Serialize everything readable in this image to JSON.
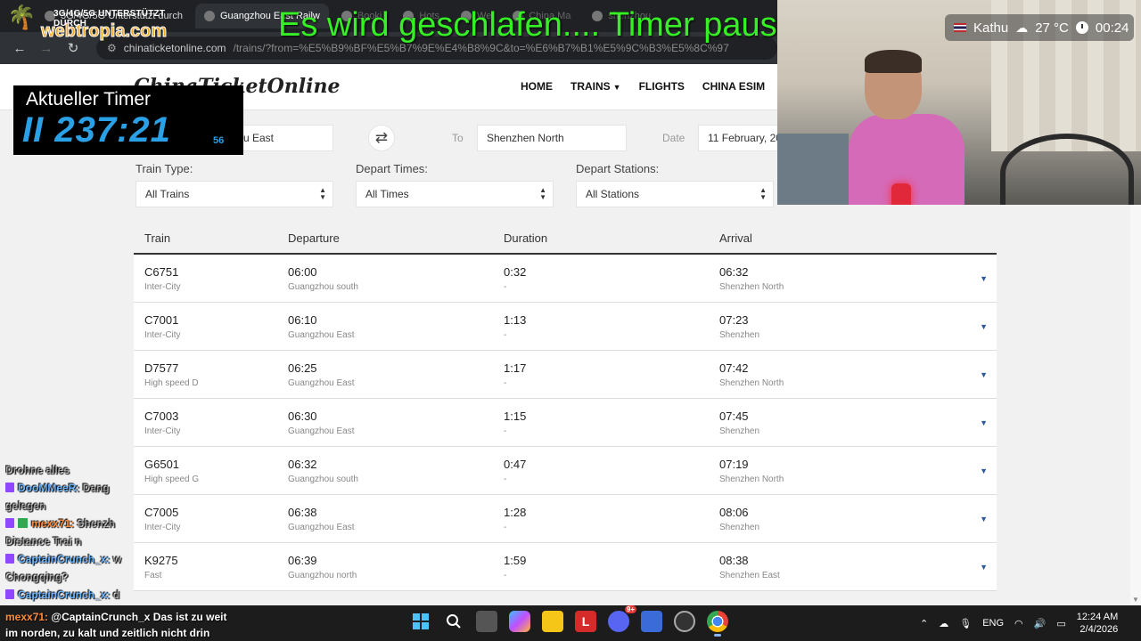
{
  "browser": {
    "tabs": [
      {
        "label": "3G/4G/5G Unterstützt durch",
        "active": false
      },
      {
        "label": "Guangzhou East Railw",
        "active": true
      },
      {
        "label": "Booki",
        "active": false
      },
      {
        "label": "Hots",
        "active": false
      },
      {
        "label": "We",
        "active": false
      },
      {
        "label": "China Ma",
        "active": false
      },
      {
        "label": "shenzhou",
        "active": false
      }
    ],
    "url_host": "chinaticketonline.com",
    "url_path": "/trains/?from=%E5%B9%BF%E5%B7%9E%E4%B8%9C&to=%E6%B7%B1%E5%9C%B3%E5%8C%97"
  },
  "site": {
    "logo": "ChinaTicketOnline",
    "nav": [
      "HOME",
      "TRAINS",
      "FLIGHTS",
      "CHINA ESIM"
    ]
  },
  "search": {
    "from_value": "u East",
    "to_label": "To",
    "to_value": "Shenzhen North",
    "date_label": "Date",
    "date_value": "11 February, 20"
  },
  "filters": [
    {
      "label": "Train Type:",
      "value": "All Trains"
    },
    {
      "label": "Depart Times:",
      "value": "All Times"
    },
    {
      "label": "Depart Stations:",
      "value": "All Stations"
    }
  ],
  "table": {
    "headers": [
      "Train",
      "Departure",
      "Duration",
      "Arrival"
    ],
    "rows": [
      {
        "train": "C6751",
        "type": "Inter-City",
        "dep": "06:00",
        "dep_station": "Guangzhou south",
        "dur": "0:32",
        "dur_sub": "-",
        "arr": "06:32",
        "arr_station": "Shenzhen North"
      },
      {
        "train": "C7001",
        "type": "Inter-City",
        "dep": "06:10",
        "dep_station": "Guangzhou East",
        "dur": "1:13",
        "dur_sub": "-",
        "arr": "07:23",
        "arr_station": "Shenzhen"
      },
      {
        "train": "D7577",
        "type": "High speed D",
        "dep": "06:25",
        "dep_station": "Guangzhou East",
        "dur": "1:17",
        "dur_sub": "-",
        "arr": "07:42",
        "arr_station": "Shenzhen North"
      },
      {
        "train": "C7003",
        "type": "Inter-City",
        "dep": "06:30",
        "dep_station": "Guangzhou East",
        "dur": "1:15",
        "dur_sub": "-",
        "arr": "07:45",
        "arr_station": "Shenzhen"
      },
      {
        "train": "G6501",
        "type": "High speed G",
        "dep": "06:32",
        "dep_station": "Guangzhou south",
        "dur": "0:47",
        "dur_sub": "-",
        "arr": "07:19",
        "arr_station": "Shenzhen North"
      },
      {
        "train": "C7005",
        "type": "Inter-City",
        "dep": "06:38",
        "dep_station": "Guangzhou East",
        "dur": "1:28",
        "dur_sub": "-",
        "arr": "08:06",
        "arr_station": "Shenzhen"
      },
      {
        "train": "K9275",
        "type": "Fast",
        "dep": "06:39",
        "dep_station": "Guangzhou north",
        "dur": "1:59",
        "dur_sub": "-",
        "arr": "08:38",
        "arr_station": "Shenzhen East"
      }
    ]
  },
  "overlay": {
    "brand": "webtropia.com",
    "brand_top": "3G/4G/5G UNTERSTÜTZT DURCH",
    "headline": "Es wird geschlafen.... Timer pausiert",
    "timer_title": "Aktueller Timer",
    "timer_value": "II 237:21",
    "timer_small": "56",
    "weather_location": "Kathu",
    "weather_temp": "27 °C",
    "weather_time": "00:24",
    "headline_color": "#35f025",
    "timer_color": "#2aa0e6"
  },
  "chat": [
    {
      "user": "",
      "text": "Drohne alles"
    },
    {
      "user": "DooMMeeR:",
      "text": "Dang"
    },
    {
      "user": "",
      "text": "gelegen"
    },
    {
      "user": "mexx71:",
      "text": "Shenzh"
    },
    {
      "user": "",
      "text": "Distance Trai n"
    },
    {
      "user": "CaptainCrunch_x:",
      "text": "w"
    },
    {
      "user": "",
      "text": "Chongqing?"
    },
    {
      "user": "CaptainCrunch_x:",
      "text": "d"
    }
  ],
  "chat_last": {
    "user": "mexx71:",
    "line1": "@CaptainCrunch_x Das ist zu weit",
    "line2": "im norden, zu kalt und zeitlich nicht drin"
  },
  "taskbar": {
    "apps": [
      "windows-start",
      "search",
      "task-view",
      "copilot",
      "file-explorer",
      "l-app",
      "discord",
      "network-app",
      "obs",
      "chrome"
    ],
    "discord_badge": "9+",
    "lang": "ENG",
    "time": "12:24 AM",
    "date": "2/4/2026"
  }
}
